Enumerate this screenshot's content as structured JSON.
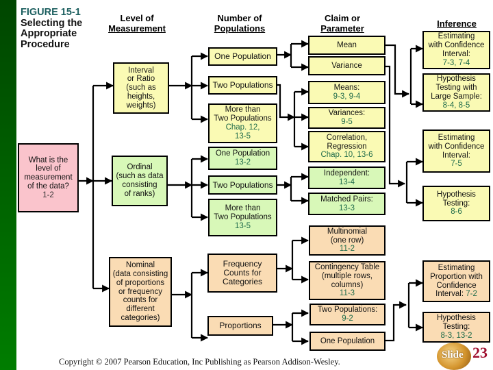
{
  "figure": {
    "number": "FIGURE 15-1",
    "title_lines": [
      "Selecting the",
      "Appropriate",
      "Procedure"
    ]
  },
  "headers": {
    "level": [
      "Level of",
      "Measurement"
    ],
    "populations": [
      "Number of",
      "Populations"
    ],
    "claim": [
      "Claim  or",
      "Parameter"
    ],
    "inference": "Inference"
  },
  "start": {
    "lines": [
      "What is the",
      "level of",
      "measurement",
      "of the data?"
    ],
    "ref": "1-2"
  },
  "levels": {
    "interval": [
      "Interval",
      "or Ratio",
      "(such as",
      "heights,",
      "weights)"
    ],
    "ordinal": [
      "Ordinal",
      "(such as data",
      "consisting",
      "of  ranks)"
    ],
    "nominal": [
      "Nominal",
      "(data consisting",
      "of proportions",
      "or frequency",
      "counts for",
      "different",
      "categories)"
    ]
  },
  "populations": {
    "interval_one": {
      "lines": [
        "One Population"
      ]
    },
    "interval_two": {
      "lines": [
        "Two Populations"
      ]
    },
    "interval_more": {
      "lines": [
        "More than",
        "Two Populations"
      ],
      "refs": [
        "Chap. 12,",
        "13-5"
      ]
    },
    "ordinal_one": {
      "lines": [
        "One Population"
      ],
      "refs": [
        "13-2"
      ]
    },
    "ordinal_two": {
      "lines": [
        "Two Populations"
      ]
    },
    "ordinal_more": {
      "lines": [
        "More than",
        "Two Populations"
      ],
      "refs": [
        "13-5"
      ]
    },
    "nominal_freq": {
      "lines": [
        "Frequency",
        "Counts for",
        "Categories"
      ]
    },
    "nominal_prop": {
      "lines": [
        "Proportions"
      ]
    }
  },
  "parameters": {
    "mean": {
      "lines": [
        "Mean"
      ]
    },
    "variance": {
      "lines": [
        "Variance"
      ]
    },
    "means": {
      "lines": [
        "Means:"
      ],
      "refs": [
        "9-3, 9-4"
      ]
    },
    "variances": {
      "lines": [
        "Variances:"
      ],
      "refs": [
        "9-5"
      ]
    },
    "correlation": {
      "lines": [
        "Correlation,",
        "Regression"
      ],
      "refs": [
        "Chap. 10,  13-6"
      ]
    },
    "independent": {
      "lines": [
        "Independent:"
      ],
      "refs": [
        "13-4"
      ]
    },
    "matched": {
      "lines": [
        "Matched Pairs:"
      ],
      "refs": [
        "13-3"
      ]
    },
    "multinomial": {
      "lines": [
        "Multinomial",
        "(one  row)"
      ],
      "refs": [
        "11-2"
      ]
    },
    "contingency": {
      "lines": [
        "Contingency Table",
        "(multiple  rows,",
        "columns)"
      ],
      "refs": [
        "11-3"
      ]
    },
    "two_pop": {
      "lines": [
        "Two  Populations:"
      ],
      "refs": [
        "9-2"
      ]
    },
    "one_pop": {
      "lines": [
        "One  Population"
      ]
    }
  },
  "inference": {
    "mean_ci": {
      "lines": [
        "Estimating",
        "with Confidence",
        "Interval:"
      ],
      "refs": [
        "7-3, 7-4"
      ]
    },
    "mean_ht": {
      "lines": [
        "Hypothesis",
        "Testing with",
        "Large Sample:"
      ],
      "refs": [
        "8-4, 8-5"
      ]
    },
    "var_ci": {
      "lines": [
        "Estimating",
        "with Confidence",
        "Interval:"
      ],
      "refs": [
        "7-5"
      ]
    },
    "var_ht": {
      "lines": [
        "Hypothesis",
        "Testing:"
      ],
      "refs": [
        "8-6"
      ]
    },
    "prop_ci": {
      "lines": [
        "Estimating",
        "Proportion with",
        "Confidence",
        "Interval: "
      ],
      "refs": [
        "7-2"
      ],
      "inline_ref": true
    },
    "prop_ht": {
      "lines": [
        "Hypothesis",
        "Testing:"
      ],
      "refs": [
        "8-3, 13-2"
      ]
    }
  },
  "footer": {
    "copyright": "Copyright © 2007 Pearson Education, Inc Publishing as Pearson Addison-Wesley.",
    "slide_label": "Slide",
    "slide_number": "23"
  },
  "colors": {
    "yellow_fill": "#fafab4",
    "green_fill": "#d8f8b8",
    "tan_fill": "#fadcb4",
    "pink_fill": "#fac4cc",
    "reference_text": "#1f6b4a",
    "figure_number": "#1b5e5e",
    "sidebar_top": "#004600",
    "sidebar_bottom": "#007d00",
    "slide_number": "#a01030"
  }
}
